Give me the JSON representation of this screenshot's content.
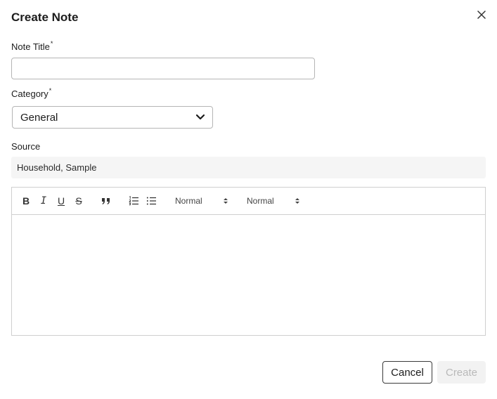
{
  "dialog": {
    "title": "Create Note",
    "close_icon": "close-icon"
  },
  "fields": {
    "title_label": "Note Title",
    "title_required": "*",
    "title_value": "",
    "title_placeholder": "",
    "category_label": "Category",
    "category_required": "*",
    "category_value": "General",
    "source_label": "Source",
    "source_value": "Household, Sample"
  },
  "toolbar": {
    "bold": "B",
    "italic": "I",
    "underline": "U",
    "strike": "S",
    "quote_icon": "blockquote-icon",
    "ordered_list_icon": "ordered-list-icon",
    "bullet_list_icon": "bullet-list-icon",
    "header_select": "Normal",
    "size_select": "Normal"
  },
  "actions": {
    "cancel_label": "Cancel",
    "create_label": "Create"
  },
  "colors": {
    "disabled_text": "#b9b9b9",
    "disabled_bg": "#f2f2f2",
    "source_bg": "#f5f5f5"
  }
}
